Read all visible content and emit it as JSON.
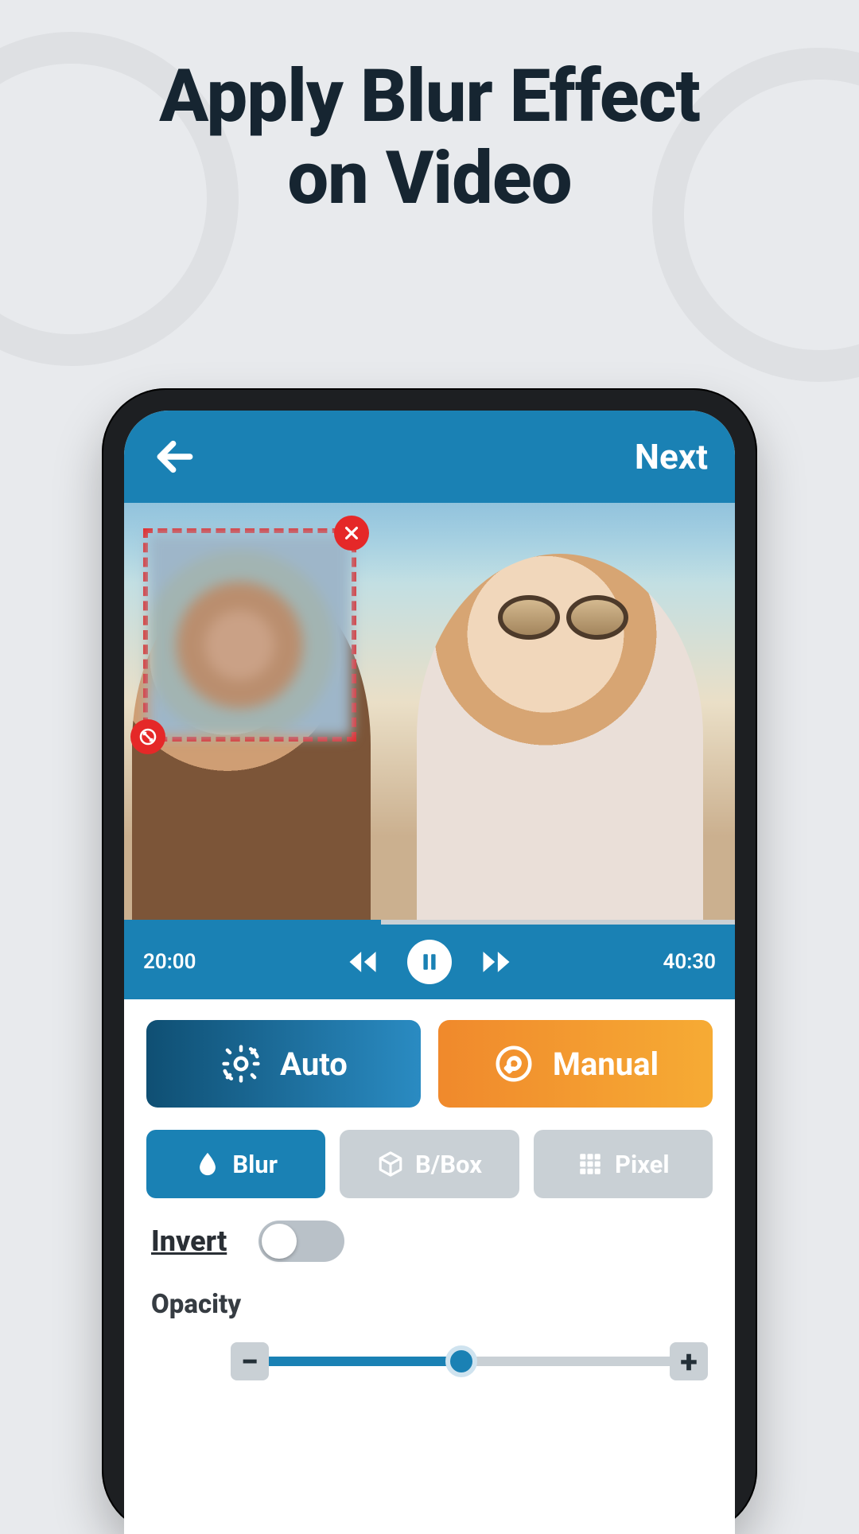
{
  "headline": {
    "line1": "Apply Blur Effect",
    "line2": "on  Video"
  },
  "appbar": {
    "next_label": "Next"
  },
  "playback": {
    "current_time": "20:00",
    "total_time": "40:30",
    "progress_percent": 42
  },
  "modes": {
    "auto_label": "Auto",
    "manual_label": "Manual"
  },
  "types": {
    "blur_label": "Blur",
    "bbox_label": "B/Box",
    "pixel_label": "Pixel"
  },
  "invert": {
    "label": "Invert",
    "enabled": false
  },
  "opacity": {
    "label": "Opacity",
    "value_percent": 48,
    "minus": "−",
    "plus": "+"
  },
  "colors": {
    "accent": "#1a81b4",
    "orange": "#f0892c",
    "danger": "#e52828"
  }
}
